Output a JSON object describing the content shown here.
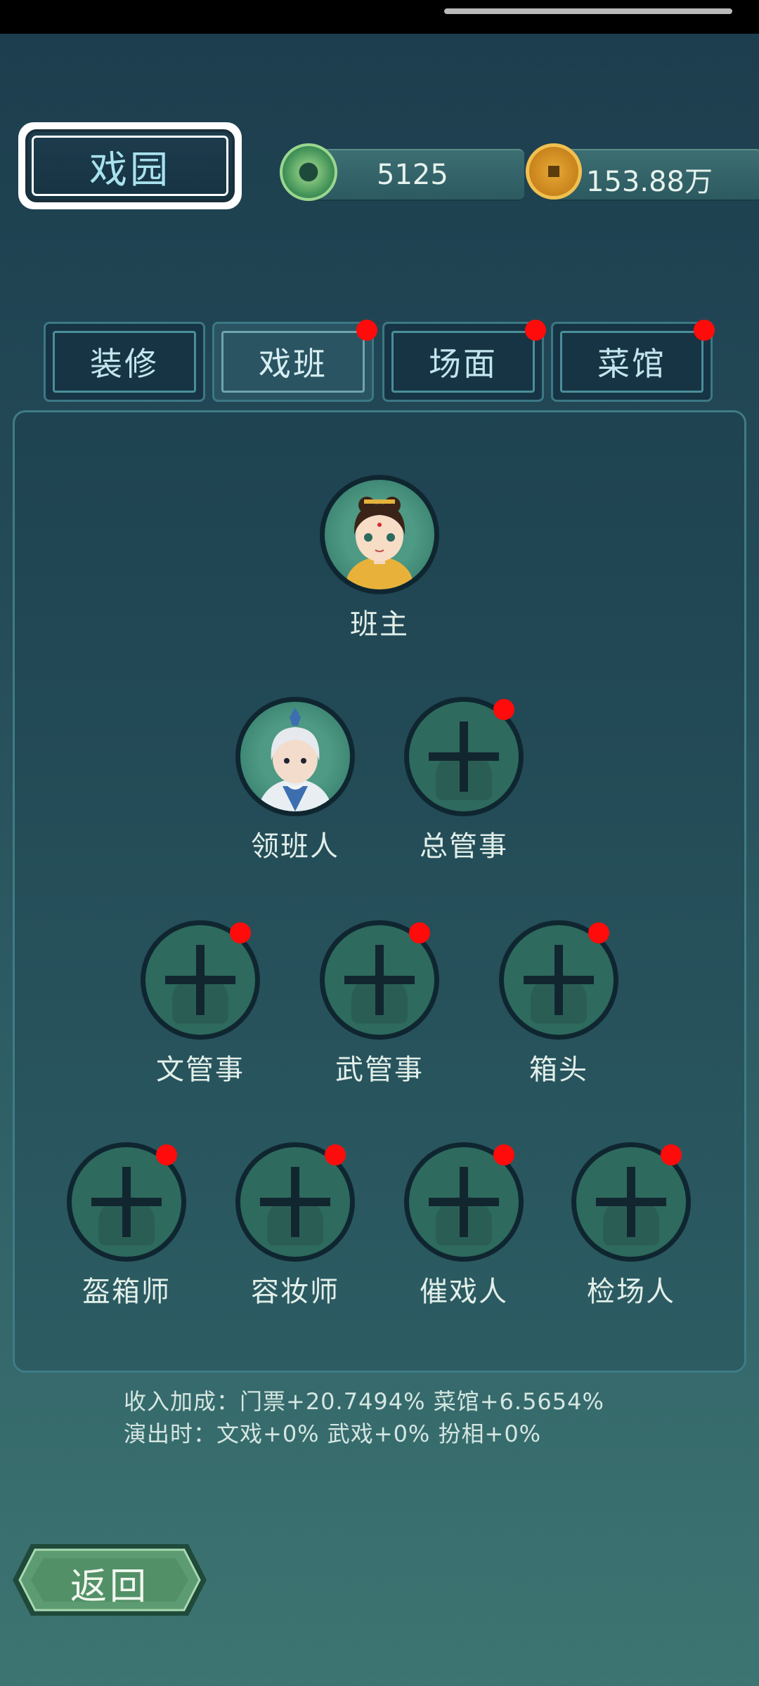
{
  "header": {
    "title": "戏园",
    "jade_count": "5125",
    "coin_count": "153.88万"
  },
  "tabs": [
    {
      "label": "装修",
      "active": false,
      "badge": false
    },
    {
      "label": "戏班",
      "active": true,
      "badge": true
    },
    {
      "label": "场面",
      "active": false,
      "badge": true
    },
    {
      "label": "菜馆",
      "active": false,
      "badge": true
    }
  ],
  "roles": {
    "leader": "班主",
    "troupe_head": "领班人",
    "chief_steward": "总管事",
    "civil_steward": "文管事",
    "martial_steward": "武管事",
    "chest_head": "箱头",
    "costume_master": "盔箱师",
    "makeup_artist": "容妆师",
    "cue_caller": "催戏人",
    "stagehand": "检场人"
  },
  "info": {
    "line1": "收入加成：门票+20.7494% 菜馆+6.5654%",
    "line2": "演出时：文戏+0% 武戏+0% 扮相+0%"
  },
  "back_label": "返回",
  "colors": {
    "accent": "#a8e2ee",
    "badge": "#ff0b0b",
    "slot": "#2e6a5e"
  }
}
